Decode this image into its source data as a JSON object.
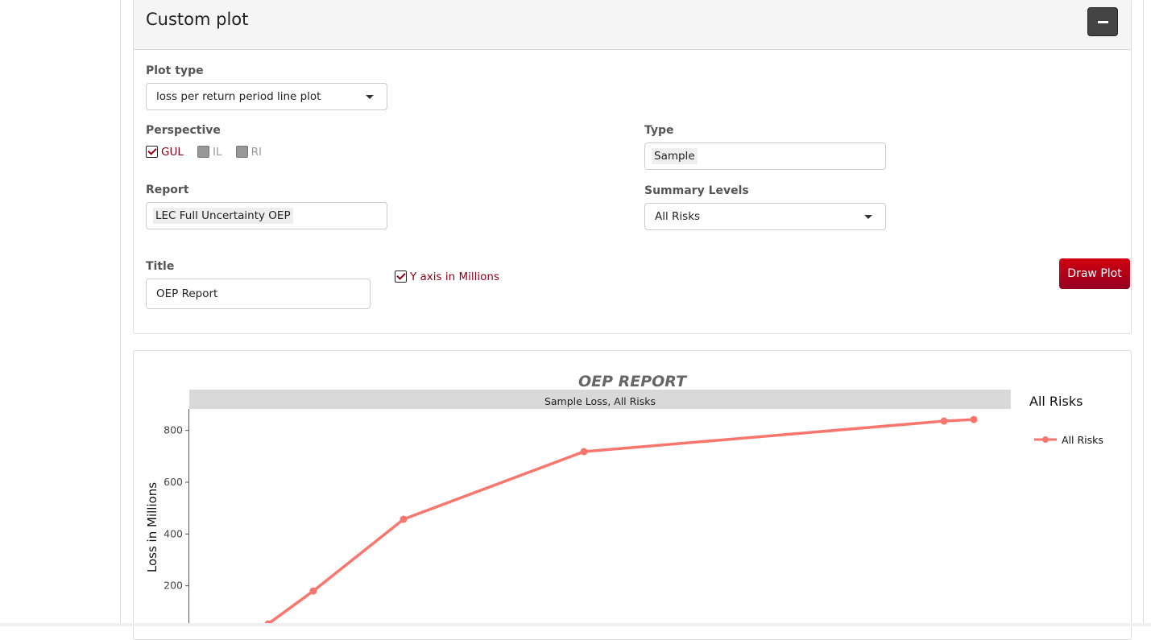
{
  "panel": {
    "title": "Custom plot",
    "collapse_icon": "minus-icon"
  },
  "form": {
    "plot_type": {
      "label": "Plot type",
      "value": "loss per return period line plot"
    },
    "perspective": {
      "label": "Perspective",
      "options": [
        {
          "label": "GUL",
          "checked": true
        },
        {
          "label": "IL",
          "checked": false
        },
        {
          "label": "RI",
          "checked": false
        }
      ]
    },
    "type": {
      "label": "Type",
      "value": "Sample"
    },
    "report": {
      "label": "Report",
      "value": "LEC Full Uncertainty OEP"
    },
    "summary_levels": {
      "label": "Summary Levels",
      "value": "All Risks"
    },
    "title": {
      "label": "Title",
      "value": "OEP Report"
    },
    "y_millions": {
      "label": "Y axis in Millions",
      "checked": true
    },
    "draw_button": "Draw Plot"
  },
  "colors": {
    "accent": "#b0001a",
    "series": "#f8766d"
  },
  "chart_data": {
    "type": "line",
    "title": "OEP REPORT",
    "facet_label": "Sample Loss, All Risks",
    "ylabel": "Loss in Millions",
    "xlabel": "",
    "yticks": [
      "200",
      "400",
      "600",
      "800"
    ],
    "ylim": [
      0,
      880
    ],
    "legend": {
      "title": "All Risks",
      "placement": "right"
    },
    "series": [
      {
        "name": "All Risks",
        "values": [
          53,
          180,
          457,
          718,
          836,
          842
        ]
      }
    ]
  }
}
